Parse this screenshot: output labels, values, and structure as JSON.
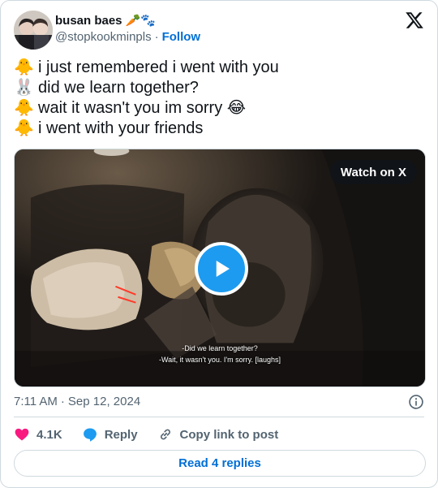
{
  "author": {
    "display_name": "busan baes",
    "name_emojis": "🥕🐾",
    "handle": "@stopkookminpls",
    "separator": "·",
    "follow_label": "Follow"
  },
  "tweet": {
    "lines": [
      {
        "emoji": "🐥",
        "text": "i just remembered i went with you"
      },
      {
        "emoji": "🐰",
        "text": "did we learn together?"
      },
      {
        "emoji": "🐥",
        "text": "wait it wasn't you im sorry 😂"
      },
      {
        "emoji": "🐥",
        "text": "i went with your friends"
      }
    ]
  },
  "media": {
    "watch_label": "Watch on X",
    "subtitle_line1": "-Did we learn together?",
    "subtitle_line2": "-Wait, it wasn't you. I'm sorry. [laughs]"
  },
  "meta": {
    "time": "7:11 AM",
    "separator": "·",
    "date": "Sep 12, 2024"
  },
  "actions": {
    "like_count": "4.1K",
    "reply_label": "Reply",
    "copy_label": "Copy link to post"
  },
  "footer": {
    "read_replies_label": "Read 4 replies"
  },
  "colors": {
    "accent": "#1d9bf0",
    "link": "#006fd6",
    "like": "#f91880",
    "muted": "#536471"
  }
}
